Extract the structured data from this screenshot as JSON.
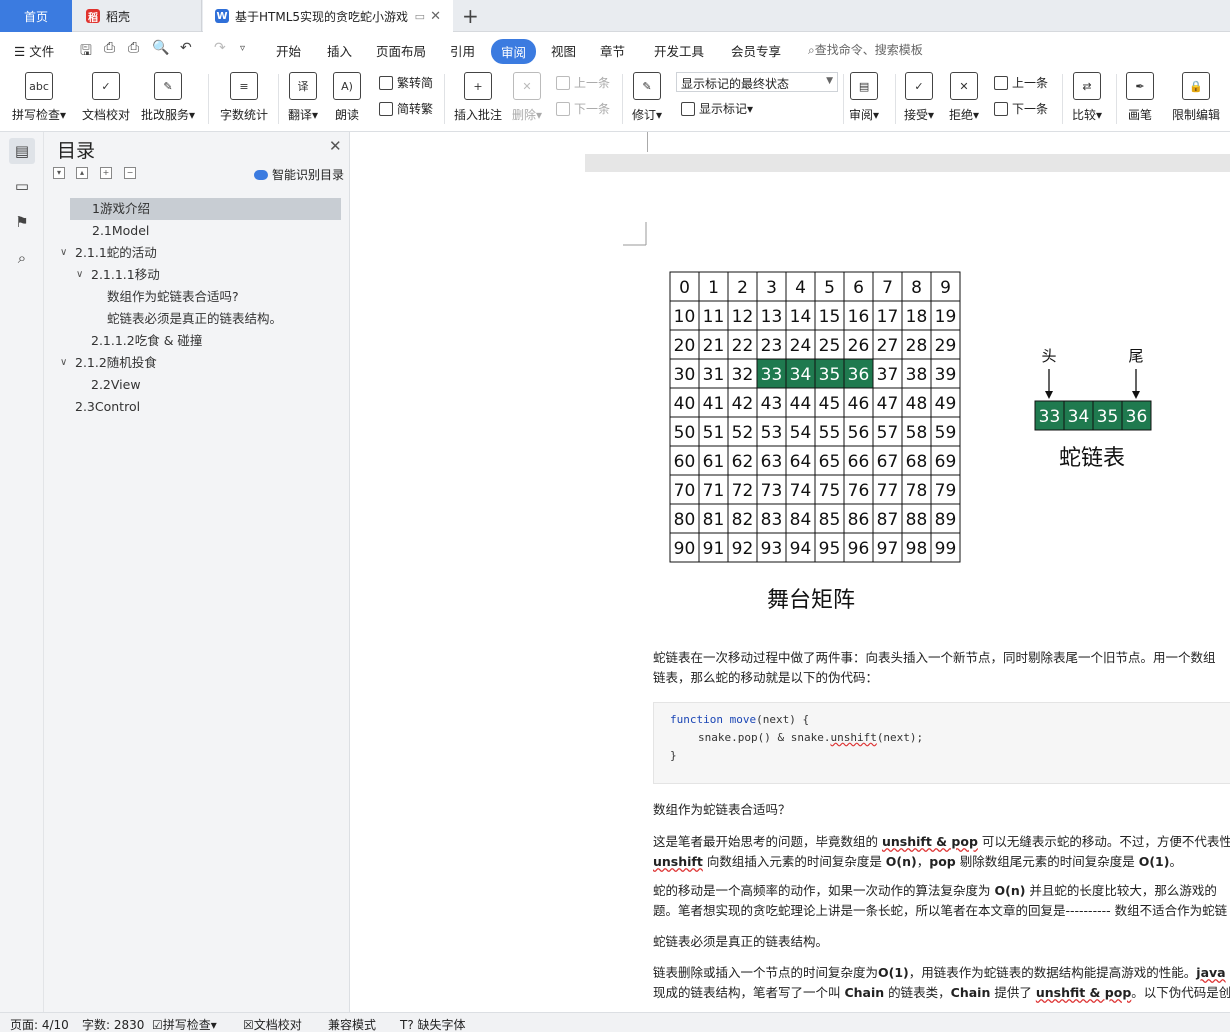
{
  "tabs": {
    "home": "首页",
    "docer": "稻壳",
    "document": "基于HTML5实现的贪吃蛇小游戏"
  },
  "menu": {
    "file": "文件",
    "items": [
      "开始",
      "插入",
      "页面布局",
      "引用",
      "审阅",
      "视图",
      "章节",
      "开发工具",
      "会员专享"
    ],
    "active": "审阅",
    "search": "查找命令、搜索模板"
  },
  "ribbon": {
    "spell_check": "拼写检查",
    "doc_proof": "文档校对",
    "review_service": "批改服务",
    "word_count": "字数统计",
    "translate": "翻译",
    "read_aloud": "朗读",
    "trad_to_simp": "繁转简",
    "simp_to_trad": "简转繁",
    "insert_comment": "插入批注",
    "delete": "删除",
    "prev_comment": "上一条",
    "next_comment": "下一条",
    "track_changes": "修订",
    "markup_mode": "显示标记的最终状态",
    "show_markup": "显示标记",
    "review": "审阅",
    "accept": "接受",
    "reject": "拒绝",
    "prev_change": "上一条",
    "next_change": "下一条",
    "compare": "比较",
    "ink": "画笔",
    "restrict_edit": "限制编辑"
  },
  "toc": {
    "title": "目录",
    "smart_toc": "智能识别目录",
    "items": [
      {
        "label": "1游戏介绍"
      },
      {
        "label": "2.1Model"
      },
      {
        "label": "2.1.1蛇的活动"
      },
      {
        "label": "2.1.1.1移动"
      },
      {
        "label": "数组作为蛇链表合适吗?"
      },
      {
        "label": "蛇链表必须是真正的链表结构。"
      },
      {
        "label": "2.1.1.2吃食 & 碰撞"
      },
      {
        "label": "2.1.2随机投食"
      },
      {
        "label": "2.2View"
      },
      {
        "label": "2.3Control"
      }
    ]
  },
  "document": {
    "grid_caption": "舞台矩阵",
    "grid_highlight": [
      33,
      34,
      35,
      36
    ],
    "highlight_color": "#1f7a4f",
    "snake_head_label": "头",
    "snake_tail_label": "尾",
    "snake_cells": [
      "33",
      "34",
      "35",
      "36"
    ],
    "snake_caption": "蛇链表",
    "p1_line1": "蛇链表在一次移动过程中做了两件事：向表头插入一个新节点，同时剔除表尾一个旧节点。用一个数组",
    "p1_line2": "链表，那么蛇的移动就是以下的伪代码：",
    "code_kw": "function",
    "code_fn": "move",
    "code_arg": "(next) {",
    "code_line2_a": "snake.pop() & snake.",
    "code_line2_b": "unshift",
    "code_line2_c": "(next);",
    "code_line3": "}",
    "h_array": "数组作为蛇链表合适吗？",
    "p2_a": "这是笔者最开始思考的问题，毕竟数组的 ",
    "p2_b": "unshift & pop",
    "p2_c": " 可以无缝表示蛇的移动。不过，方便不代表性",
    "p2_d": "unshift",
    "p2_e": " 向数组插入元素的时间复杂度是 ",
    "p2_f": "O(n)",
    "p2_g": "，",
    "p2_h": "pop",
    "p2_i": " 剔除数组尾元素的时间复杂度是 ",
    "p2_j": "O(1)",
    "p2_k": "。",
    "p3_a": "蛇的移动是一个高频率的动作，如果一次动作的算法复杂度为 ",
    "p3_b": "O(n)",
    "p3_c": " 并且蛇的长度比较大，那么游戏的",
    "p3_line2": "题。笔者想实现的贪吃蛇理论上讲是一条长蛇，所以笔者在本文章的回复是---------- 数组不适合作为蛇链",
    "h_linked": "蛇链表必须是真正的链表结构。",
    "p4_a": "链表删除或插入一个节点的时间复杂度为",
    "p4_b": "O(1)",
    "p4_c": "，用链表作为蛇链表的数据结构能提高游戏的性能。",
    "p4_d": "java",
    "p4_e": "现成的链表结构，笔者写了一个叫 ",
    "p4_f": "Chain",
    "p4_g": " 的链表类，",
    "p4_h": "Chain",
    "p4_i": " 提供了 ",
    "p4_j": "unshfit & pop",
    "p4_k": "。以下伪代码是创"
  },
  "status": {
    "page": "页面: 4/10",
    "words": "字数: 2830",
    "spell": "拼写检查",
    "proof": "文档校对",
    "compat": "兼容模式",
    "missing_font": "缺失字体"
  }
}
